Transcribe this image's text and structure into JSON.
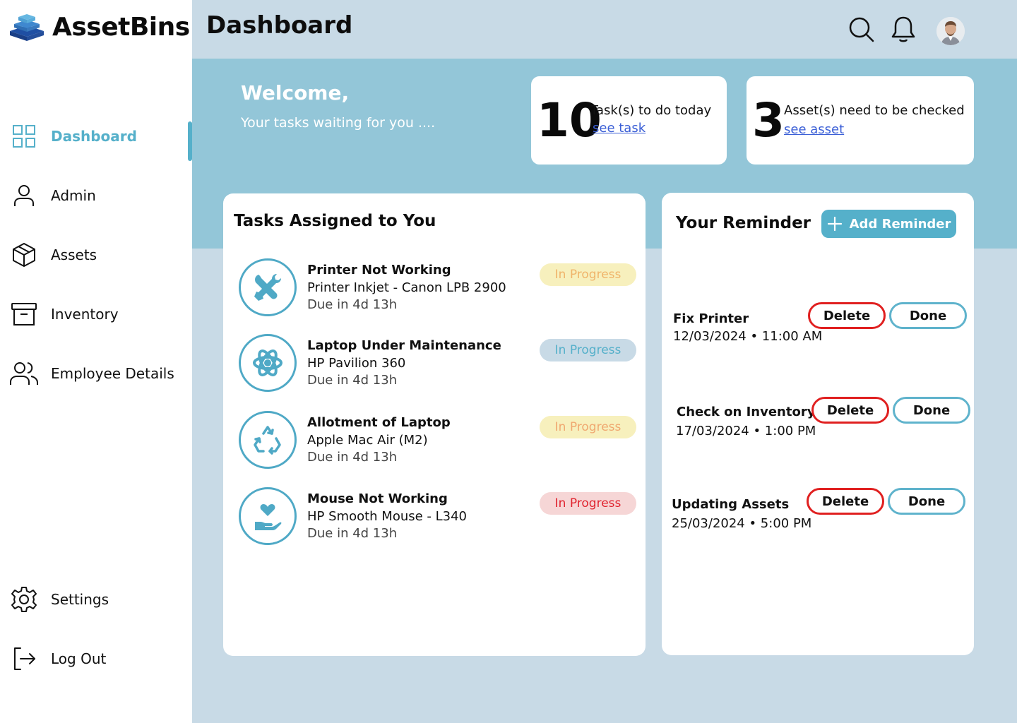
{
  "app": {
    "name": "AssetBins"
  },
  "header": {
    "title": "Dashboard"
  },
  "sidebar": {
    "items": [
      {
        "label": "Dashboard",
        "icon": "grid-icon",
        "active": true
      },
      {
        "label": "Admin",
        "icon": "user-icon"
      },
      {
        "label": "Assets",
        "icon": "box-icon"
      },
      {
        "label": "Inventory",
        "icon": "archive-icon"
      },
      {
        "label": "Employee Details",
        "icon": "users-icon"
      }
    ],
    "bottom": [
      {
        "label": "Settings",
        "icon": "gear-icon"
      },
      {
        "label": "Log Out",
        "icon": "logout-icon"
      }
    ]
  },
  "banner": {
    "welcome": "Welcome,",
    "subtitle": "Your tasks waiting for you ....",
    "tasks_card": {
      "count": "10",
      "text": "Task(s) to do today",
      "link": "see task"
    },
    "assets_card": {
      "count": "3",
      "text": "Asset(s) need to be checked",
      "link": "see asset"
    }
  },
  "tasks": {
    "title": "Tasks Assigned to You",
    "items": [
      {
        "title": "Printer Not Working",
        "subtitle": "Printer Inkjet - Canon LPB 2900",
        "due": "Due in 4d 13h",
        "status": "In Progress",
        "icon": "tools-icon",
        "badge_bg": "#f7f0bd",
        "badge_fg": "#f0b46a"
      },
      {
        "title": "Laptop Under Maintenance",
        "subtitle": "HP Pavilion 360",
        "due": "Due in 4d 13h",
        "status": "In Progress",
        "icon": "atom-icon",
        "badge_bg": "#c8dae6",
        "badge_fg": "#55b0ca"
      },
      {
        "title": "Allotment of Laptop",
        "subtitle": "Apple Mac Air (M2)",
        "due": "Due in 4d 13h",
        "status": "In Progress",
        "icon": "recycle-icon",
        "badge_bg": "#f7f0bd",
        "badge_fg": "#f0a870"
      },
      {
        "title": "Mouse Not Working",
        "subtitle": "HP Smooth Mouse - L340",
        "due": "Due in 4d 13h",
        "status": "In Progress",
        "icon": "hand-heart-icon",
        "badge_bg": "#f6d6d6",
        "badge_fg": "#e0232e"
      }
    ]
  },
  "reminders": {
    "title": "Your Reminder",
    "add_label": "Add Reminder",
    "delete_label": "Delete",
    "done_label": "Done",
    "items": [
      {
        "title": "Fix Printer",
        "time": "12/03/2024 • 11:00 AM"
      },
      {
        "title": "Check on Inventory",
        "time": "17/03/2024 • 1:00 PM"
      },
      {
        "title": "Updating Assets",
        "time": "25/03/2024 • 5:00 PM"
      }
    ]
  },
  "colors": {
    "accent": "#55b0ca",
    "banner": "#93c6d8",
    "background": "#c8dae6",
    "danger": "#e02020"
  }
}
